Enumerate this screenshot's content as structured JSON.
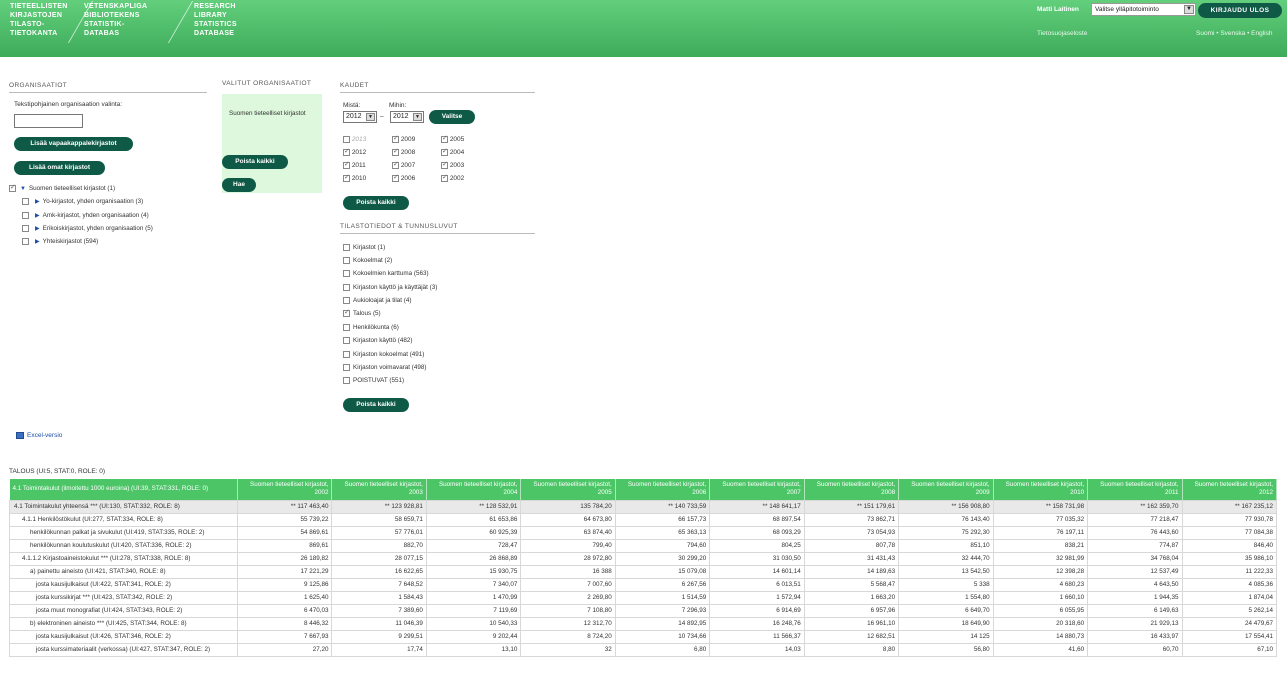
{
  "header": {
    "databases": [
      {
        "label": "TIETEELLISTEN\nKIRJASTOJEN\nTILASTO-\nTIETOKANTA"
      },
      {
        "label": "VETENSKAPLIGA\nBIBLIOTEKENS\nSTATISTIK-\nDATABAS"
      },
      {
        "label": "RESEARCH\nLIBRARY\nSTATISTICS\nDATABASE"
      }
    ],
    "user_name": "Matti Laitinen",
    "admin_select": "Valitse ylläpitotoiminto",
    "logout_label": "KIRJAUDU ULOS",
    "privacy_label": "Tietosuojaseloste",
    "languages": [
      "Suomi",
      "Svenska",
      "English"
    ],
    "lang_sep": " • "
  },
  "organisations": {
    "title": "ORGANISAATIOT",
    "text_label": "Tekstipohjainen organisaation valinta:",
    "input_value": "",
    "add_legal_deposit": "Lisää vapaakappalekirjastot",
    "add_own": "Lisää omat kirjastot",
    "tree": [
      {
        "label": "Suomen tieteelliset kirjastot (1)",
        "checked": true,
        "expanded": true
      },
      {
        "label": "Yo-kirjastot, yhden organisaation (3)",
        "checked": false
      },
      {
        "label": "Amk-kirjastot, yhden organisaation (4)",
        "checked": false
      },
      {
        "label": "Erikoiskirjastot, yhden organisaation (5)",
        "checked": false
      },
      {
        "label": "Yhteiskirjastot (594)",
        "checked": false
      }
    ]
  },
  "selected": {
    "title": "VALITUT ORGANISAATIOT",
    "items": "Suomen tieteelliset kirjastot",
    "clear_label": "Poista kaikki",
    "fetch_label": "Hae"
  },
  "periods": {
    "title": "KAUDET",
    "from_label": "Mistä:",
    "to_label": "Mihin:",
    "from_value": "2012",
    "to_value": "2012",
    "dash": "–",
    "choose_label": "Valitse",
    "years": [
      {
        "year": "2013",
        "checked": false,
        "muted": true
      },
      {
        "year": "2012",
        "checked": true
      },
      {
        "year": "2011",
        "checked": true
      },
      {
        "year": "2010",
        "checked": true
      },
      {
        "year": "2009",
        "checked": true
      },
      {
        "year": "2008",
        "checked": true
      },
      {
        "year": "2007",
        "checked": true
      },
      {
        "year": "2006",
        "checked": true
      },
      {
        "year": "2005",
        "checked": true
      },
      {
        "year": "2004",
        "checked": true
      },
      {
        "year": "2003",
        "checked": true
      },
      {
        "year": "2002",
        "checked": true
      }
    ],
    "clear_label": "Poista kaikki"
  },
  "statistics": {
    "title": "TILASTOTIEDOT & TUNNUSLUVUT",
    "items": [
      {
        "label": "Kirjastot (1)",
        "checked": false
      },
      {
        "label": "Kokoelmat (2)",
        "checked": false
      },
      {
        "label": "Kokoelmien karttuma (563)",
        "checked": false
      },
      {
        "label": "Kirjaston käyttö ja käyttäjät (3)",
        "checked": false
      },
      {
        "label": "Aukioloajat ja tilat (4)",
        "checked": false
      },
      {
        "label": "Talous (5)",
        "checked": true
      },
      {
        "label": "Henkilökunta (6)",
        "checked": false
      },
      {
        "label": "Kirjaston käyttö (482)",
        "checked": false
      },
      {
        "label": "Kirjaston kokoelmat (491)",
        "checked": false
      },
      {
        "label": "Kirjaston voimavarat (498)",
        "checked": false
      },
      {
        "label": "POISTUVAT (551)",
        "checked": false
      }
    ],
    "clear_label": "Poista kaikki"
  },
  "excel_label": "Excel-versio",
  "table": {
    "caption": "TALOUS (UI:5, STAT:0, ROLE: 0)",
    "first_header": "4.1 Toimintakulut (ilmoitettu 1000 euroina) (UI:39, STAT:331, ROLE: 0)",
    "column_prefix": "Suomen tieteelliset kirjastot, ",
    "columns": [
      "2002",
      "2003",
      "2004",
      "2005",
      "2006",
      "2007",
      "2008",
      "2009",
      "2010",
      "2011",
      "2012"
    ],
    "rows": [
      {
        "level": 0,
        "label": "4.1 Toimintakulut yhteensä *** (UI:130, STAT:332, ROLE: 8)",
        "values": [
          "** 117 463,40",
          "** 123 928,81",
          "** 128 532,91",
          "135 784,20",
          "** 140 733,59",
          "** 148 641,17",
          "** 151 179,61",
          "** 156 908,80",
          "** 158 731,98",
          "** 162 359,70",
          "** 167 235,12"
        ]
      },
      {
        "level": 1,
        "label": "4.1.1 Henkilöstökulut (UI:277, STAT:334, ROLE: 8)",
        "values": [
          "55 739,22",
          "58 659,71",
          "61 653,86",
          "64 673,80",
          "66 157,73",
          "68 897,54",
          "73 862,71",
          "76 143,40",
          "77 035,32",
          "77 218,47",
          "77 930,78"
        ]
      },
      {
        "level": 2,
        "label": "henkilökunnan palkat ja sivukulut (UI:419, STAT:335, ROLE: 2)",
        "values": [
          "54 869,61",
          "57 776,01",
          "60 925,39",
          "63 874,40",
          "65 363,13",
          "68 093,29",
          "73 054,93",
          "75 292,30",
          "76 197,11",
          "76 443,60",
          "77 084,38"
        ]
      },
      {
        "level": 2,
        "label": "henkilökunnan koulutuskulut (UI:420, STAT:336, ROLE: 2)",
        "values": [
          "869,61",
          "882,70",
          "728,47",
          "799,40",
          "794,60",
          "804,25",
          "807,78",
          "851,10",
          "838,21",
          "774,87",
          "846,40"
        ]
      },
      {
        "level": 1,
        "label": "4.1.1.2 Kirjastoaineistokulut *** (UI:278, STAT:338, ROLE: 8)",
        "values": [
          "26 189,82",
          "28 077,15",
          "26 868,89",
          "28 972,80",
          "30 299,20",
          "31 030,50",
          "31 431,43",
          "32 444,70",
          "32 981,99",
          "34 768,04",
          "35 986,10"
        ]
      },
      {
        "level": 2,
        "label": "a) painettu aineisto (UI:421, STAT:340, ROLE: 8)",
        "values": [
          "17 221,29",
          "16 622,65",
          "15 930,75",
          "16 388",
          "15 079,08",
          "14 601,14",
          "14 189,63",
          "13 542,50",
          "12 398,28",
          "12 537,49",
          "11 222,33"
        ]
      },
      {
        "level": 3,
        "label": "josta kausijulkaisut (UI:422, STAT:341, ROLE: 2)",
        "values": [
          "9 125,86",
          "7 648,52",
          "7 340,07",
          "7 007,60",
          "6 267,56",
          "6 013,51",
          "5 568,47",
          "5 338",
          "4 680,23",
          "4 643,50",
          "4 085,36"
        ]
      },
      {
        "level": 3,
        "label": "josta kurssikirjat *** (UI:423, STAT:342, ROLE: 2)",
        "values": [
          "1 625,40",
          "1 584,43",
          "1 470,99",
          "2 269,80",
          "1 514,59",
          "1 572,94",
          "1 663,20",
          "1 554,80",
          "1 660,10",
          "1 944,35",
          "1 874,04"
        ]
      },
      {
        "level": 3,
        "label": "josta muut monografiat (UI:424, STAT:343, ROLE: 2)",
        "values": [
          "6 470,03",
          "7 389,60",
          "7 119,69",
          "7 108,80",
          "7 296,93",
          "6 914,69",
          "6 957,96",
          "6 649,70",
          "6 055,95",
          "6 149,63",
          "5 262,14"
        ]
      },
      {
        "level": 2,
        "label": "b) elektroninen aineisto *** (UI:425, STAT:344, ROLE: 8)",
        "values": [
          "8 446,32",
          "11 046,39",
          "10 540,33",
          "12 312,70",
          "14 892,95",
          "16 248,76",
          "16 961,10",
          "18 649,90",
          "20 318,60",
          "21 929,13",
          "24 479,67"
        ]
      },
      {
        "level": 3,
        "label": "josta kausijulkaisut (UI:426, STAT:346, ROLE: 2)",
        "values": [
          "7 667,93",
          "9 299,51",
          "9 202,44",
          "8 724,20",
          "10 734,66",
          "11 566,37",
          "12 682,51",
          "14 125",
          "14 880,73",
          "16 433,97",
          "17 554,41"
        ]
      },
      {
        "level": 3,
        "label": "josta kurssimateriaalit (verkossa) (UI:427, STAT:347, ROLE: 2)",
        "values": [
          "27,20",
          "17,74",
          "13,10",
          "32",
          "6,80",
          "14,03",
          "8,80",
          "56,80",
          "41,60",
          "60,70",
          "67,10"
        ]
      }
    ]
  }
}
